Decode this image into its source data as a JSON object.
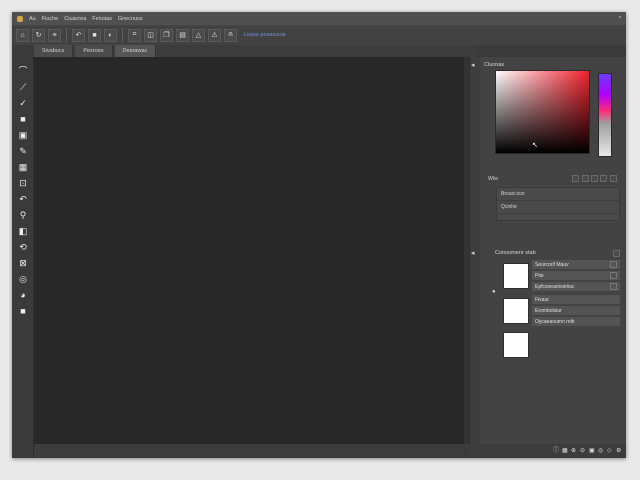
{
  "menubar": {
    "items": [
      "Au",
      "Fiuche",
      "Ciuacrea",
      "Fenoias",
      "Gnecnuss"
    ],
    "close_icon": "close-icon"
  },
  "toolbar": {
    "icons": [
      "home-icon",
      "refresh-icon",
      "list-icon",
      "undo-icon",
      "stop-icon",
      "drop-icon",
      "crop-icon",
      "layers-icon",
      "copy-icon",
      "doc-icon",
      "triangle-icon",
      "warning-icon",
      "person-icon"
    ],
    "label": "Lease pceasucar"
  },
  "tabs": [
    {
      "label": "Sivabucs",
      "active": false
    },
    {
      "label": "Pesroes",
      "active": false
    },
    {
      "label": "Dearawac",
      "active": true
    }
  ],
  "tools": [
    "curve-tool-icon",
    "brush-tool-icon",
    "check-tool-icon",
    "rect-tool-icon",
    "image-tool-icon",
    "pen-tool-icon",
    "gradient-tool-icon",
    "transform-tool-icon",
    "lasso-tool-icon",
    "eyedropper-tool-icon",
    "shape-tool-icon",
    "rotate-tool-icon",
    "zoom-tool-icon",
    "clone-tool-icon",
    "paint-tool-icon",
    "fill-tool-icon"
  ],
  "color_panel": {
    "title": "Cluonas",
    "hex_label": "Wke",
    "mode_label": "Brouoi:sce",
    "preset_label": "Qcinhe"
  },
  "layers_panel": {
    "title": "Coooomenr stab",
    "rows": [
      {
        "label": "Seurcorif Mauv"
      },
      {
        "label": "Pite"
      },
      {
        "label": "Epfcsoeannoiriiac"
      },
      {
        "label": "Fivaur."
      },
      {
        "label": "Erombolsiur"
      },
      {
        "label": "Oycaeaoumn roib"
      }
    ]
  },
  "status": {
    "icons": [
      "info-icon",
      "grid-icon",
      "zoom-in-icon",
      "zoom-out-icon",
      "fit-icon",
      "snap-icon",
      "warn-icon",
      "settings-icon"
    ]
  }
}
